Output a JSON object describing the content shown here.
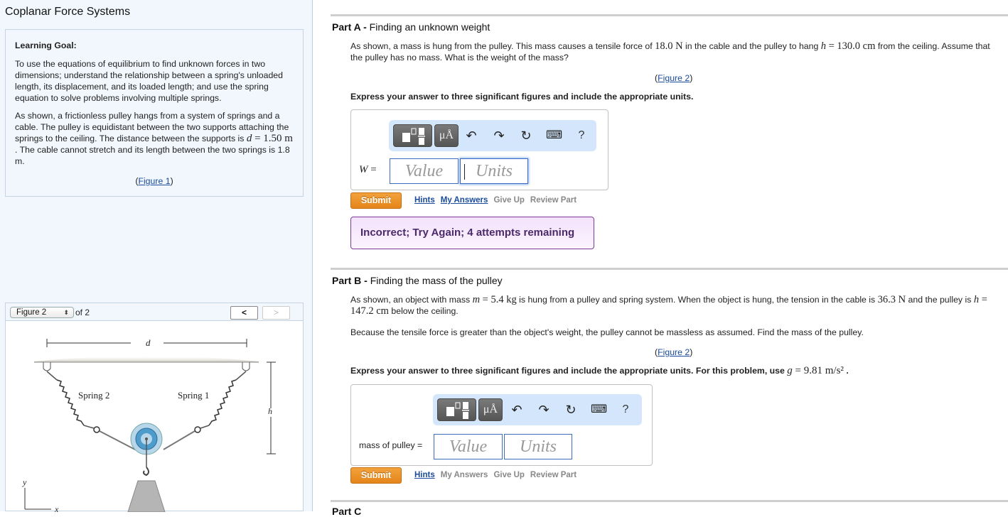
{
  "page": {
    "title": "Coplanar Force Systems"
  },
  "learning_goal": {
    "heading": "Learning Goal:",
    "paragraph1": "To use the equations of equilibrium to find unknown forces in two dimensions; understand the relationship between a spring's unloaded length, its displacement, and its loaded length; and use the spring equation to solve problems involving multiple springs.",
    "paragraph2_a": "As shown, a frictionless pulley hangs from a system of springs and a cable. The pulley is equidistant between the two supports attaching the springs to the ceiling. The distance between the supports is ",
    "paragraph2_var": "d",
    "paragraph2_eq": " = 1.50 m",
    "paragraph2_b": " . The cable cannot stretch and its length between the two springs is 1.8 m.",
    "figure_link_open": "(",
    "figure_link": "Figure 1",
    "figure_link_close": ")"
  },
  "figure_viewer": {
    "selected": "Figure 2",
    "of_label": "of 2",
    "prev_label": "<",
    "next_label": ">",
    "labels": {
      "d": "d",
      "h": "h",
      "spring2": "Spring 2",
      "spring1": "Spring 1",
      "y": "y",
      "x": "x"
    }
  },
  "part_a": {
    "title_prefix": "Part A",
    "title_sep": " - ",
    "title": "Finding an unknown weight",
    "text_1": "As shown, a mass is hung from the pulley. This mass causes a tensile force of ",
    "force": "18.0 N",
    "text_2": " in the cable and the pulley to hang ",
    "h_var": "h",
    "h_eq": " = 130.0 cm",
    "text_3": " from the ceiling. Assume that the pulley has no mass. What is the weight of the mass?",
    "figure_link": "Figure 2",
    "instruction": "Express your answer to three significant figures and include the appropriate units.",
    "answer_var": "W",
    "answer_eq": " =",
    "value_placeholder": "Value",
    "units_placeholder": "Units",
    "submit": "Submit",
    "links": [
      "Hints",
      "My Answers",
      "Give Up",
      "Review Part"
    ],
    "feedback": "Incorrect; Try Again; 4 attempts remaining"
  },
  "part_b": {
    "title_prefix": "Part B",
    "title_sep": " - ",
    "title": "Finding the mass of the pulley",
    "text_1": "As shown, an object with mass ",
    "m_var": "m",
    "m_eq": " = 5.4 kg",
    "text_2": " is hung from a pulley and spring system. When the object is hung, the tension in the cable is ",
    "tension": "36.3 N",
    "text_3": " and the pulley is ",
    "h_var": "h",
    "h_eq": " = 147.2 cm",
    "text_4": " below the ceiling.",
    "text_5": "Because the tensile force is greater than the object's weight, the pulley cannot be massless as assumed. Find the mass of the pulley.",
    "figure_link": "Figure 2",
    "instruction": "Express your answer to three significant figures and include the appropriate units. For this problem, use ",
    "g_var": "g",
    "g_eq": " = 9.81 m/s²",
    "instruction_end": " .",
    "answer_label": "mass of pulley =",
    "value_placeholder": "Value",
    "units_placeholder": "Units",
    "submit": "Submit",
    "links": [
      "Hints",
      "My Answers",
      "Give Up",
      "Review Part"
    ]
  },
  "part_c": {
    "title_prefix": "Part C"
  },
  "toolbar": {
    "units_label": "μÅ",
    "undo_icon": "↶",
    "redo_icon": "↷",
    "reset_icon": "↻",
    "keyboard_icon": "⌨",
    "help_label": "?"
  }
}
